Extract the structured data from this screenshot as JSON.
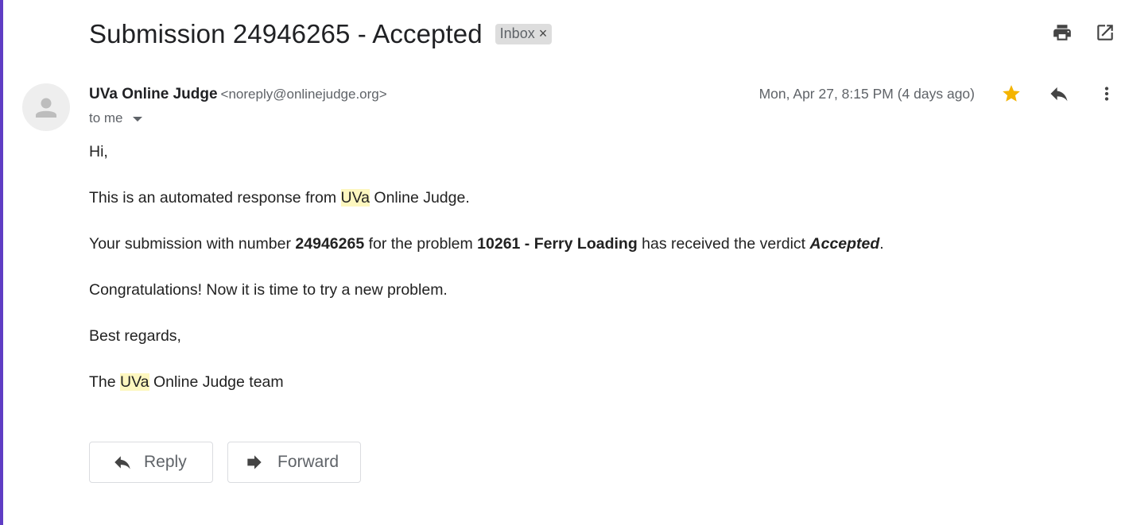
{
  "email": {
    "subject": "Submission 24946265 - Accepted",
    "label": "Inbox",
    "label_remove": "×",
    "sender_name": "UVa Online Judge",
    "sender_email": "<noreply@onlinejudge.org>",
    "recipient_text": "to me",
    "date": "Mon, Apr 27, 8:15 PM (4 days ago)",
    "starred": true,
    "star_color": "#f4b400"
  },
  "body": {
    "greeting": "Hi,",
    "line1": {
      "pre": "This is an automated response from ",
      "highlight": "UVa",
      "post": " Online Judge."
    },
    "line2": {
      "pre": "Your submission with number ",
      "number": "24946265",
      "mid": " for the problem ",
      "problem": "10261 - Ferry Loading",
      "mid2": " has received the verdict ",
      "verdict": "Accepted",
      "post": "."
    },
    "line3": "Congratulations! Now it is time to try a new problem.",
    "line4": "Best regards,",
    "line5": {
      "pre": "The ",
      "highlight": "UVa",
      "post": " Online Judge team"
    }
  },
  "actions": {
    "reply_label": "Reply",
    "forward_label": "Forward"
  },
  "icons": {
    "print": "print-icon",
    "open_new_window": "open-in-new-window-icon",
    "star": "star-icon",
    "reply": "reply-icon",
    "more": "more-vertical-icon",
    "avatar": "default-avatar-icon",
    "forward": "forward-icon"
  },
  "colors": {
    "highlight": "#fdf7bf",
    "left_edge": "#5f3dc4"
  }
}
